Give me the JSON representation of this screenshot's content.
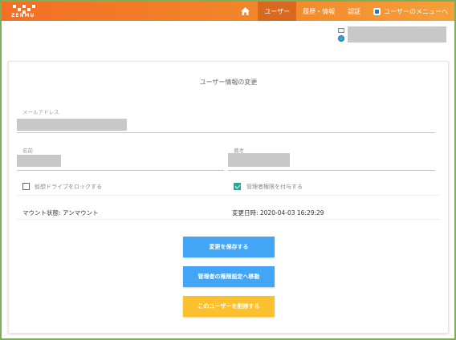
{
  "nav": {
    "items": [
      {
        "label": "ユーザー",
        "active": true
      },
      {
        "label": "履歴・情報",
        "active": false
      },
      {
        "label": "認証",
        "active": false
      },
      {
        "label": "ユーザーのメニューへ",
        "active": false
      }
    ]
  },
  "logo": {
    "text": "ZENMU"
  },
  "form": {
    "title": "ユーザー情報の変更",
    "email_label": "メールアドレス",
    "name_label": "名前",
    "note_label": "備考",
    "lock_drive_label": "仮想ドライブをロックする",
    "lock_drive_checked": false,
    "admin_label": "管理者権限を付与する",
    "admin_checked": true,
    "mount_status": "マウント状態: アンマウント",
    "updated_at": "変更日時: 2020-04-03 16:29:29"
  },
  "buttons": {
    "save": "変更を保存する",
    "admin_settings": "管理者の権限設定へ移動",
    "delete": "このユーザーを削除する"
  },
  "colors": {
    "topbar": "#f3872a",
    "primary": "#42a5f5",
    "warning": "#fbc02d",
    "checkbox": "#26a69a"
  }
}
